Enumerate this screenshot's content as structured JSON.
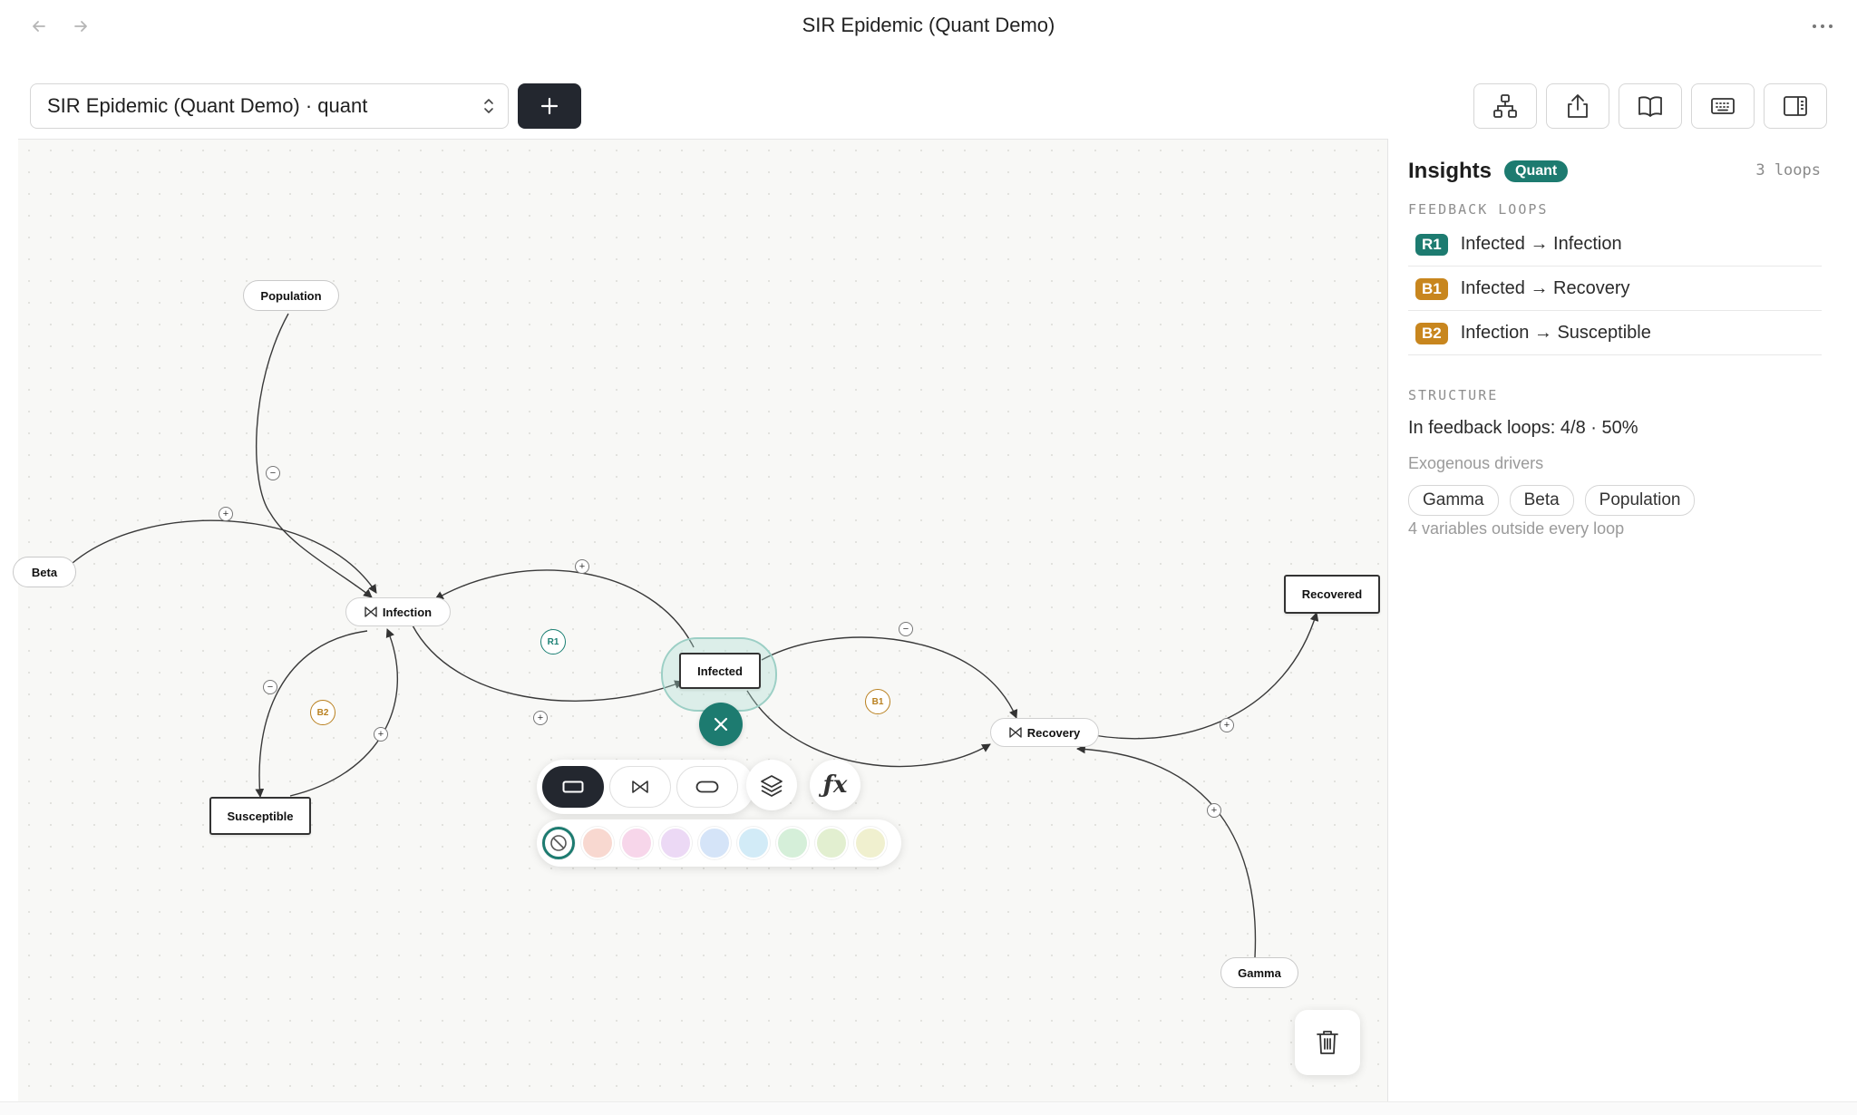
{
  "window": {
    "title": "SIR Epidemic (Quant Demo)"
  },
  "toolbar": {
    "model_select_value": "SIR Epidemic (Quant Demo) · quant",
    "add_label": "+"
  },
  "canvas": {
    "nodes": {
      "population": "Population",
      "beta": "Beta",
      "infection": "Infection",
      "infected": "Infected",
      "recovery": "Recovery",
      "recovered": "Recovered",
      "susceptible": "Susceptible",
      "gamma": "Gamma"
    },
    "loop_badges": {
      "r1": "R1",
      "b1": "B1",
      "b2": "B2"
    },
    "polarity": {
      "plus": "+",
      "minus": "−"
    },
    "format_bar": {
      "shapes": [
        "stock",
        "flow",
        "auxiliary"
      ],
      "swatch_colors": [
        "#f8d8d0",
        "#f7d6ea",
        "#ecd9f5",
        "#d5e4f8",
        "#d2ebf7",
        "#d5efd9",
        "#e2efd0",
        "#f0f0cf"
      ],
      "fx_label": "ƒx"
    }
  },
  "insights": {
    "title": "Insights",
    "badge": "Quant",
    "loop_count": "3 loops",
    "feedback_label": "FEEDBACK LOOPS",
    "loops": [
      {
        "tag": "R1",
        "text": "Infected → Infection",
        "color": "#1d7b70"
      },
      {
        "tag": "B1",
        "text": "Infected → Recovery",
        "color": "#c8861e"
      },
      {
        "tag": "B2",
        "text": "Infection → Susceptible",
        "color": "#c8861e"
      }
    ],
    "structure_label": "STRUCTURE",
    "structure_line": "In feedback loops: 4/8 · 50%",
    "exogenous_label": "Exogenous drivers",
    "drivers": [
      "Gamma",
      "Beta",
      "Population"
    ],
    "outside_note": "4 variables outside every loop"
  },
  "colors": {
    "accent": "#1d7b70",
    "balancing": "#c8861e",
    "dark": "#23272f"
  }
}
